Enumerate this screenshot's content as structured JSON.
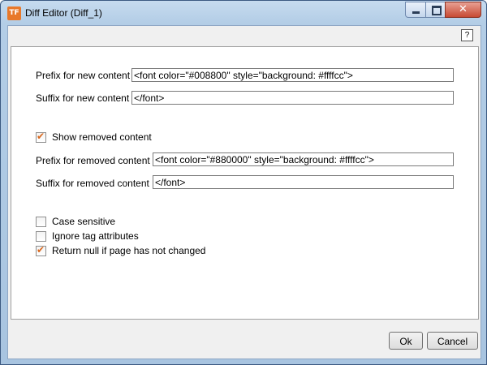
{
  "window": {
    "title": "Diff Editor (Diff_1)",
    "logo_text": "TF",
    "minimize": "",
    "maximize": "",
    "close": "✕"
  },
  "help": "?",
  "form": {
    "prefix_new_label": "Prefix for new content",
    "prefix_new_value": "<font color=\"#008800\" style=\"background: #ffffcc\">",
    "suffix_new_label": "Suffix for new content",
    "suffix_new_value": "</font>",
    "show_removed_label": "Show removed content",
    "show_removed_checked": true,
    "prefix_removed_label": "Prefix for removed content",
    "prefix_removed_value": "<font color=\"#880000\" style=\"background: #ffffcc\">",
    "suffix_removed_label": "Suffix for removed content",
    "suffix_removed_value": "</font>",
    "case_sensitive_label": "Case sensitive",
    "case_sensitive_checked": false,
    "ignore_tag_label": "Ignore tag attributes",
    "ignore_tag_checked": false,
    "return_null_label": "Return null if page has not changed",
    "return_null_checked": true,
    "check_glyph": "✔"
  },
  "buttons": {
    "ok": "Ok",
    "cancel": "Cancel"
  }
}
